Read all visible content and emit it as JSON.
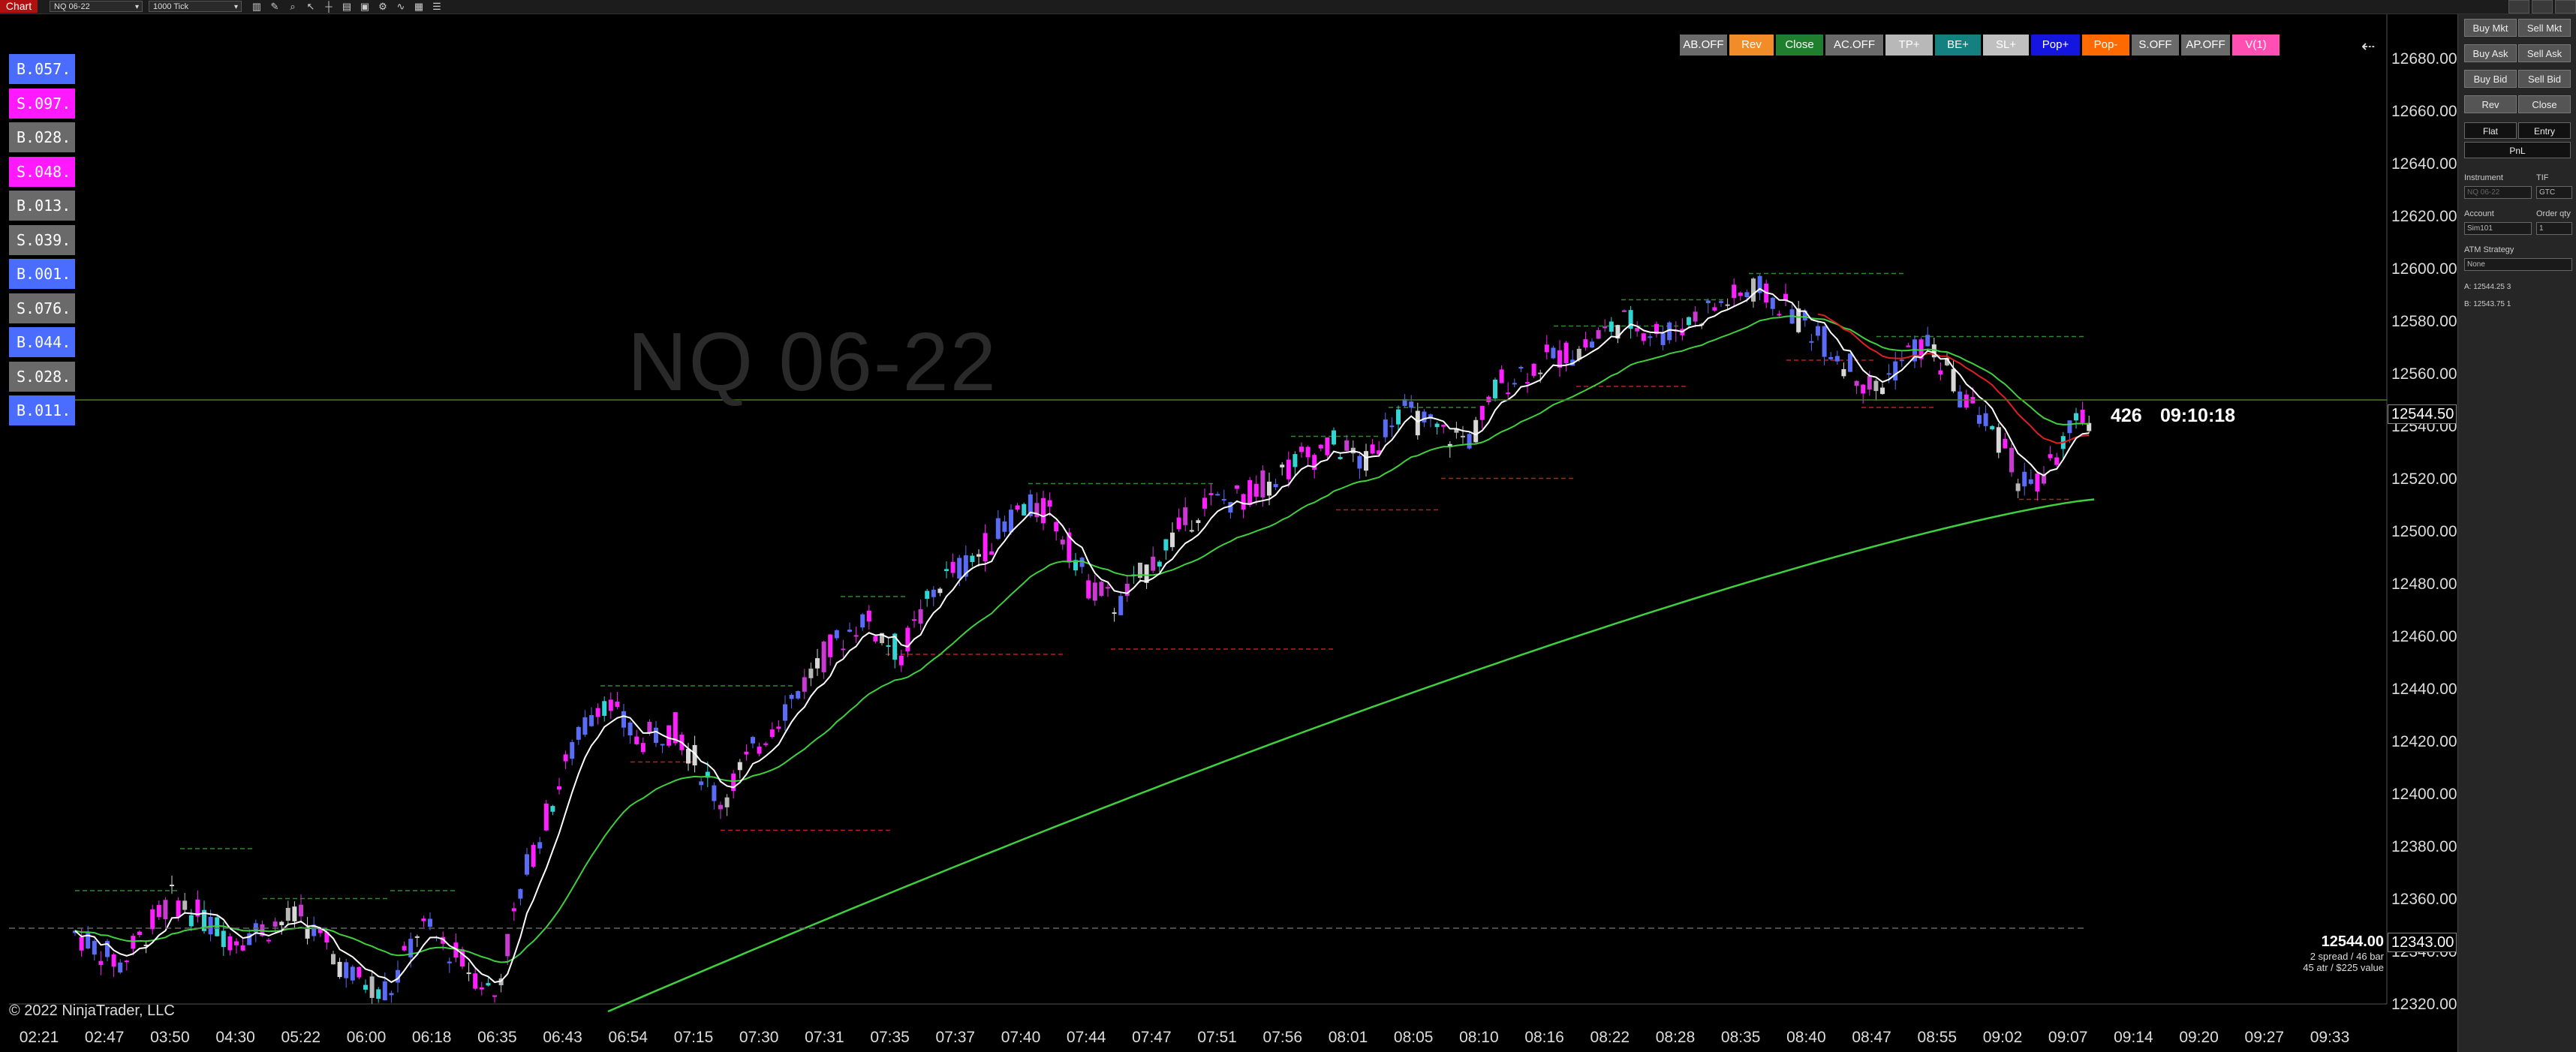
{
  "toolbar": {
    "chart_tab": "Chart",
    "instrument": "NQ 06-22",
    "interval": "1000 Tick",
    "icons": [
      "bar-type-icon",
      "draw-icon",
      "zoom-icon",
      "cursor-icon",
      "crosshair-icon",
      "template-icon",
      "properties-icon",
      "strategy-icon",
      "indicator-icon",
      "data-box-icon",
      "table-icon"
    ]
  },
  "watermark": "NQ 06-22",
  "copyright": "© 2022 NinjaTrader, LLC",
  "top_buttons": [
    {
      "label": "AB.OFF",
      "bg": "#6b6b6b"
    },
    {
      "label": "Rev",
      "bg": "#f28c28"
    },
    {
      "label": "Close",
      "bg": "#1f7f2f"
    },
    {
      "label": "AC.OFF",
      "bg": "#6b6b6b"
    },
    {
      "label": "TP+",
      "bg": "#b8b8b8"
    },
    {
      "label": "BE+",
      "bg": "#158080"
    },
    {
      "label": "SL+",
      "bg": "#c0c0c0"
    },
    {
      "label": "Pop+",
      "bg": "#1515e0"
    },
    {
      "label": "Pop-",
      "bg": "#ff6a00"
    },
    {
      "label": "S.OFF",
      "bg": "#6b6b6b"
    },
    {
      "label": "AP.OFF",
      "bg": "#6b6b6b"
    },
    {
      "label": "V(1)",
      "bg": "#ff4fb3"
    }
  ],
  "order_tags": [
    {
      "label": "B.057.",
      "color": "#4a6cff"
    },
    {
      "label": "S.097.",
      "color": "#ff19ff"
    },
    {
      "label": "B.028.",
      "color": "#6a6a6a"
    },
    {
      "label": "S.048.",
      "color": "#ff19ff"
    },
    {
      "label": "B.013.",
      "color": "#6a6a6a"
    },
    {
      "label": "S.039.",
      "color": "#6a6a6a"
    },
    {
      "label": "B.001.",
      "color": "#4a6cff"
    },
    {
      "label": "S.076.",
      "color": "#6a6a6a"
    },
    {
      "label": "B.044.",
      "color": "#4a6cff"
    },
    {
      "label": "S.028.",
      "color": "#6a6a6a"
    },
    {
      "label": "B.011.",
      "color": "#4a6cff"
    }
  ],
  "price_labels": [
    "12680.00",
    "12660.00",
    "12640.00",
    "12620.00",
    "12600.00",
    "12580.00",
    "12560.00",
    "12540.00",
    "12520.00",
    "12500.00",
    "12480.00",
    "12460.00",
    "12440.00",
    "12420.00",
    "12400.00",
    "12380.00",
    "12360.00",
    "12340.00",
    "12320.00"
  ],
  "current_price": "12544.50",
  "marker_price": "12343.00",
  "bar_count": "426",
  "bar_timer": "09:10:18",
  "info_box": {
    "price": "12544.00",
    "line1": "2 spread / 46 bar",
    "line2": "45 atr / $225 value"
  },
  "time_labels": [
    "02:21",
    "02:47",
    "03:50",
    "04:30",
    "05:22",
    "06:00",
    "06:18",
    "06:35",
    "06:43",
    "06:54",
    "07:15",
    "07:30",
    "07:31",
    "07:35",
    "07:37",
    "07:40",
    "07:44",
    "07:47",
    "07:51",
    "07:56",
    "08:01",
    "08:05",
    "08:10",
    "08:16",
    "08:22",
    "08:28",
    "08:35",
    "08:40",
    "08:47",
    "08:55",
    "09:02",
    "09:07",
    "09:14",
    "09:20",
    "09:27",
    "09:33"
  ],
  "panel": {
    "row1": [
      "Buy Mkt",
      "Sell Mkt"
    ],
    "row2": [
      "Buy Ask",
      "Sell Ask"
    ],
    "row3": [
      "Buy Bid",
      "Sell Bid"
    ],
    "row4": [
      "Rev",
      "Close"
    ],
    "row5": [
      "Flat",
      "Entry"
    ],
    "pnl": "PnL",
    "instrument_label": "Instrument",
    "tif_label": "TIF",
    "instrument_value": "NQ 06-22",
    "tif_value": "GTC",
    "account_label": "Account",
    "orderqty_label": "Order qty",
    "account_value": "Sim101",
    "orderqty_value": "1",
    "atm_label": "ATM Strategy",
    "atm_value": "None",
    "ask_line": "A:  12544.25     3",
    "bid_line": "B:  12543.75     1"
  }
}
